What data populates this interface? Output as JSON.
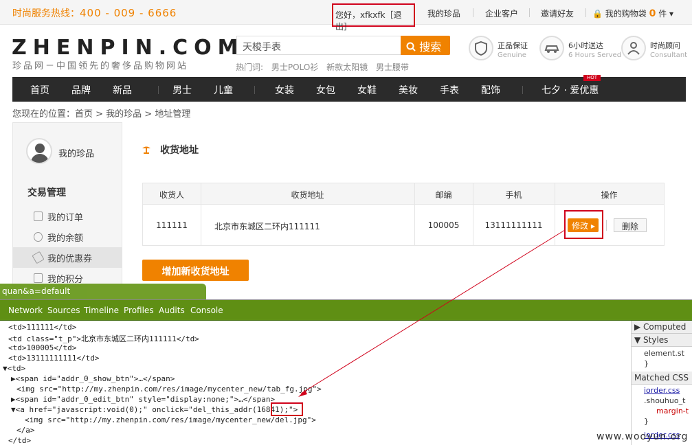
{
  "topbar": {
    "hotline_label": "时尚服务热线：",
    "hotline_number": "400 - 009 - 6666",
    "greeting": "您好，xfkxfk［退出］",
    "links": [
      "我的珍品",
      "企业客户",
      "邀请好友"
    ],
    "cart_label": "我的购物袋",
    "cart_count": "0",
    "cart_unit": "件 ▾"
  },
  "header": {
    "logo": "ZHENPIN.COM",
    "logo_sub": "珍品网－中国领先的奢侈品购物网站",
    "search_value": "天梭手表",
    "search_button": "搜索",
    "hotwords_label": "热门词:",
    "hotwords": [
      "男士POLO衫",
      "新款太阳镜",
      "男士腰带"
    ],
    "services": [
      {
        "title": "正品保证",
        "sub": "Genuine",
        "icon": "shield-icon"
      },
      {
        "title": "6小时送达",
        "sub": "6 Hours Served",
        "icon": "car-icon"
      },
      {
        "title": "时尚顾问",
        "sub": "Consultant",
        "icon": "person-icon"
      }
    ]
  },
  "nav": {
    "items": [
      "首页",
      "品牌",
      "新品",
      "男士",
      "儿童",
      "女装",
      "女包",
      "女鞋",
      "美妆",
      "手表",
      "配饰",
      "七夕 · 爱优惠"
    ],
    "hot_badge": "HOT"
  },
  "breadcrumb": "您现在的位置：首页 > 我的珍品 > 地址管理",
  "sidebar": {
    "my_label": "我的珍品",
    "section_title": "交易管理",
    "items": [
      {
        "label": "我的订单",
        "icon": "order-icon"
      },
      {
        "label": "我的余额",
        "icon": "balance-icon"
      },
      {
        "label": "我的优惠券",
        "icon": "coupon-icon"
      },
      {
        "label": "我的积分",
        "icon": "points-icon"
      }
    ]
  },
  "main": {
    "title": "收货地址",
    "table": {
      "headers": [
        "收货人",
        "收货地址",
        "邮编",
        "手机",
        "操作"
      ],
      "row": {
        "name": "111111",
        "address": "北京市东城区二环内111111",
        "zip": "100005",
        "phone": "13111111111",
        "edit": "修改 ▸",
        "delete": "删除"
      }
    },
    "add_button": "增加新收货地址"
  },
  "url_fragment": "quan&a=default",
  "devtools": {
    "tabs": [
      "Network",
      "Sources",
      "Timeline",
      "Profiles",
      "Audits",
      "Console"
    ],
    "lines": [
      {
        "indent": 12,
        "text": "<td>111111</td>"
      },
      {
        "indent": 12,
        "text": "<td class=\"t_p\">北京市东城区二环内111111</td>"
      },
      {
        "indent": 12,
        "text": "<td>100005</td>"
      },
      {
        "indent": 12,
        "text": "<td>13111111111</td>"
      },
      {
        "indent": 4,
        "text": "▼<td>"
      },
      {
        "indent": 16,
        "text": "▶<span id=\"addr_0_show_btn\">…</span>"
      },
      {
        "indent": 24,
        "text": "<img src=\"http://my.zhenpin.com/res/image/mycenter_new/tab_fg.jpg\">"
      },
      {
        "indent": 16,
        "text": "▶<span id=\"addr_0_edit_btn\" style=\"display:none;\">…</span>"
      },
      {
        "indent": 16,
        "text": "▼<a href=\"javascript:void(0);\" onclick=\"del_this_addr(16841);\">"
      },
      {
        "indent": 36,
        "text": "<img src=\"http://my.zhenpin.com/res/image/mycenter_new/del.jpg\">"
      },
      {
        "indent": 24,
        "text": "</a>"
      },
      {
        "indent": 12,
        "text": "</td>"
      }
    ],
    "side": {
      "computed": "▶ Computed",
      "styles": "▼ Styles",
      "element_style": "element.st",
      "brace": "}",
      "matched": "Matched CSS",
      "file1": "iorder.css",
      "selector": ".shouhuo_t",
      "prop": "margin-t",
      "file2": "iorder.css"
    }
  },
  "watermark": "www.wooyun.org"
}
